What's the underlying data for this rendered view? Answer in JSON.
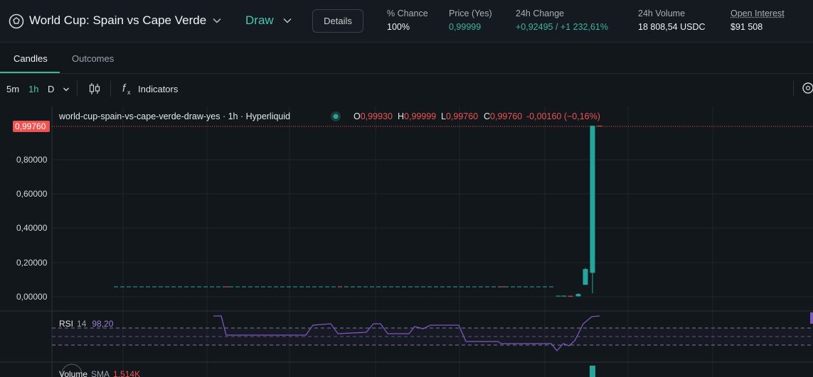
{
  "header": {
    "market_title": "World Cup: Spain vs Cape Verde",
    "outcome": "Draw",
    "details_label": "Details",
    "stats": [
      {
        "label": "% Chance",
        "value": "100%",
        "color": "#f1f3f5"
      },
      {
        "label": "Price (Yes)",
        "value": "0,99999",
        "color": "#3fb49b"
      },
      {
        "label": "24h Change",
        "value": "+0,92495 / +1 232,61%",
        "color": "#3fb49b"
      },
      {
        "label": "24h Volume",
        "value": "18 808,54 USDC",
        "color": "#f1f3f5"
      },
      {
        "label": "Open Interest",
        "value": "$91 508",
        "color": "#f1f3f5"
      }
    ]
  },
  "tabs": [
    {
      "label": "Candles",
      "active": true
    },
    {
      "label": "Outcomes",
      "active": false
    }
  ],
  "toolbar": {
    "intervals": [
      "5m",
      "1h",
      "D"
    ],
    "active_interval": "1h",
    "indicators_label": "Indicators"
  },
  "legend": {
    "symbol": "world-cup-spain-vs-cape-verde-draw-yes · 1h · Hyperliquid",
    "o_label": "O",
    "o_value": "0,99930",
    "h_label": "H",
    "h_value": "0,99999",
    "l_label": "L",
    "l_value": "0,99760",
    "c_label": "C",
    "c_value": "0,99760",
    "change": "-0,00160 (−0,16%)"
  },
  "price_axis": {
    "current_price": "0,99760",
    "ticks": [
      "0,80000",
      "0,60000",
      "0,40000",
      "0,20000",
      "0,00000"
    ]
  },
  "rsi": {
    "label": "RSI",
    "period": "14",
    "value": "98,20"
  },
  "volume": {
    "label": "Volume",
    "sma_label": "SMA",
    "sma_value": "1,514K"
  },
  "colors": {
    "up": "#26a69a",
    "down": "#ef5350",
    "rsi": "#7e57c2",
    "accent": "#3fb49b"
  },
  "chart_data": {
    "type": "candlestick",
    "ylim": [
      0,
      1
    ],
    "candles": [
      {
        "o": 0.006,
        "h": 0.0065,
        "l": 0.005,
        "c": 0.006
      },
      {
        "o": 0.006,
        "h": 0.008,
        "l": 0.0035,
        "c": 0.006
      },
      {
        "o": 0.0055,
        "h": 0.0058,
        "l": 0.0015,
        "c": 0.005
      },
      {
        "o": 0.003,
        "h": 0.021,
        "l": 0.001,
        "c": 0.016
      },
      {
        "o": 0.07,
        "h": 0.17,
        "l": 0.07,
        "c": 0.162
      },
      {
        "o": 0.14,
        "h": 1.0,
        "l": 0.02,
        "c": 0.9993
      },
      {
        "o": 0.9993,
        "h": 0.99999,
        "l": 0.9976,
        "c": 0.9976
      }
    ]
  }
}
